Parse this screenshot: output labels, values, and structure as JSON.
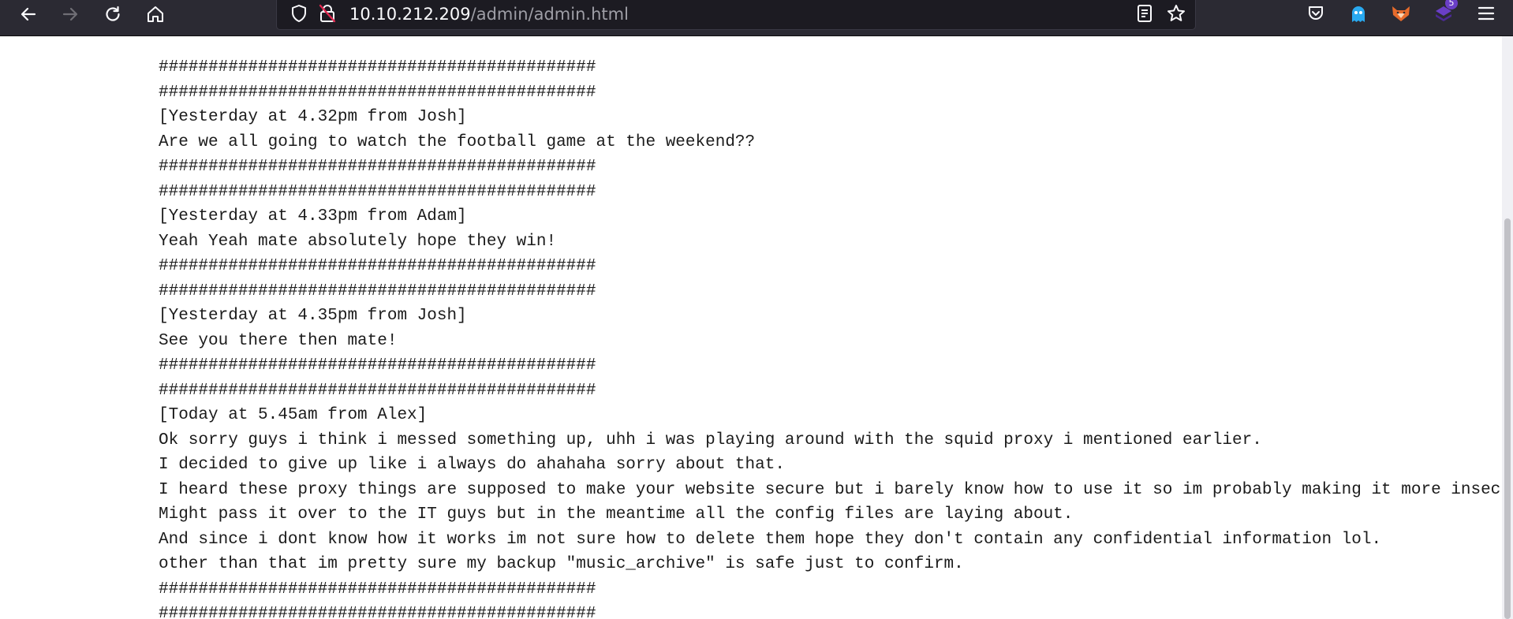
{
  "browser": {
    "url_host": "10.10.212.209",
    "url_path": "/admin/admin.html",
    "extension_badge": "5",
    "icons": {
      "back": "arrow-left-icon",
      "forward": "arrow-right-icon",
      "reload": "reload-icon",
      "home": "home-icon",
      "tracking": "shield-icon",
      "insecure": "lock-insecure-icon",
      "reader": "reader-view-icon",
      "bookmark": "star-icon",
      "pocket": "pocket-icon",
      "ghost": "ghost-extension-icon",
      "fox": "fox-extension-icon",
      "hack": "extension-badge-icon",
      "menu": "hamburger-menu-icon"
    },
    "colors": {
      "toolbar": "#2b2a33",
      "urlbar": "#1c1b22",
      "url_host": "#fbfbfe",
      "url_path": "#9e9ea6",
      "insecure_accent": "#e22850"
    }
  },
  "page": {
    "lines": [
      "############################################",
      "############################################",
      "[Yesterday at 4.32pm from Josh]",
      "Are we all going to watch the football game at the weekend??",
      "############################################",
      "############################################",
      "[Yesterday at 4.33pm from Adam]",
      "Yeah Yeah mate absolutely hope they win!",
      "############################################",
      "############################################",
      "[Yesterday at 4.35pm from Josh]",
      "See you there then mate!",
      "############################################",
      "############################################",
      "[Today at 5.45am from Alex]",
      "Ok sorry guys i think i messed something up, uhh i was playing around with the squid proxy i mentioned earlier.",
      "I decided to give up like i always do ahahaha sorry about that.",
      "I heard these proxy things are supposed to make your website secure but i barely know how to use it so im probably making it more insecure in the process.",
      "Might pass it over to the IT guys but in the meantime all the config files are laying about.",
      "And since i dont know how it works im not sure how to delete them hope they don't contain any confidential information lol.",
      "other than that im pretty sure my backup \"music_archive\" is safe just to confirm.",
      "############################################",
      "############################################"
    ]
  }
}
